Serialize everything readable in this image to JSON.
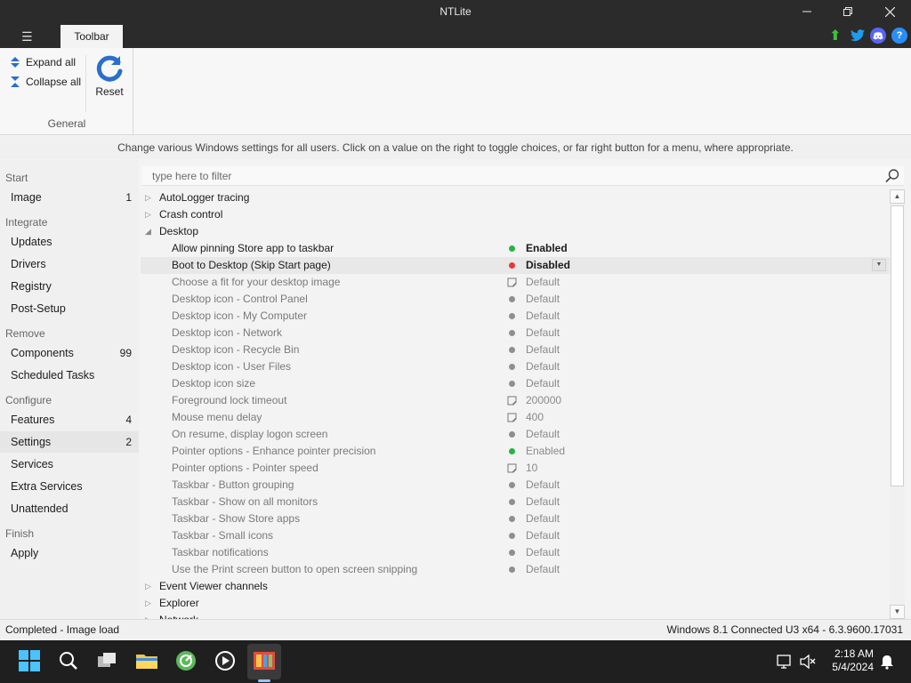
{
  "window": {
    "title": "NTLite"
  },
  "ribbon": {
    "tab": "Toolbar",
    "expand_all": "Expand all",
    "collapse_all": "Collapse all",
    "reset": "Reset",
    "group": "General"
  },
  "info": "Change various Windows settings for all users. Click on a value on the right to toggle choices, or far right button for a menu, where appropriate.",
  "sidebar": {
    "sections": [
      "Start",
      "Integrate",
      "Remove",
      "Configure",
      "Finish"
    ],
    "items": [
      {
        "label": "Image",
        "count": "1"
      },
      {
        "label": "Updates",
        "count": ""
      },
      {
        "label": "Drivers",
        "count": ""
      },
      {
        "label": "Registry",
        "count": ""
      },
      {
        "label": "Post-Setup",
        "count": ""
      },
      {
        "label": "Components",
        "count": "99"
      },
      {
        "label": "Scheduled Tasks",
        "count": ""
      },
      {
        "label": "Features",
        "count": "4"
      },
      {
        "label": "Settings",
        "count": "2"
      },
      {
        "label": "Services",
        "count": ""
      },
      {
        "label": "Extra Services",
        "count": ""
      },
      {
        "label": "Unattended",
        "count": ""
      },
      {
        "label": "Apply",
        "count": ""
      }
    ]
  },
  "filter": {
    "placeholder": "type here to filter"
  },
  "tree": {
    "categories_top": [
      "AutoLogger tracing",
      "Crash control",
      "Desktop"
    ],
    "settings": [
      {
        "name": "Allow pinning Store app to taskbar",
        "value": "Enabled",
        "status": "green"
      },
      {
        "name": "Boot to Desktop (Skip Start page)",
        "value": "Disabled",
        "status": "red"
      },
      {
        "name": "Choose a fit for your desktop image",
        "value": "Default",
        "status": "edit"
      },
      {
        "name": "Desktop icon - Control Panel",
        "value": "Default",
        "status": "grey"
      },
      {
        "name": "Desktop icon - My Computer",
        "value": "Default",
        "status": "grey"
      },
      {
        "name": "Desktop icon - Network",
        "value": "Default",
        "status": "grey"
      },
      {
        "name": "Desktop icon - Recycle Bin",
        "value": "Default",
        "status": "grey"
      },
      {
        "name": "Desktop icon - User Files",
        "value": "Default",
        "status": "grey"
      },
      {
        "name": "Desktop icon size",
        "value": "Default",
        "status": "grey"
      },
      {
        "name": "Foreground lock timeout",
        "value": "200000",
        "status": "edit"
      },
      {
        "name": "Mouse menu delay",
        "value": "400",
        "status": "edit"
      },
      {
        "name": "On resume, display logon screen",
        "value": "Default",
        "status": "grey"
      },
      {
        "name": "Pointer options - Enhance pointer precision",
        "value": "Enabled",
        "status": "green"
      },
      {
        "name": "Pointer options - Pointer speed",
        "value": "10",
        "status": "edit"
      },
      {
        "name": "Taskbar - Button grouping",
        "value": "Default",
        "status": "grey"
      },
      {
        "name": "Taskbar - Show on all monitors",
        "value": "Default",
        "status": "grey"
      },
      {
        "name": "Taskbar - Show Store apps",
        "value": "Default",
        "status": "grey"
      },
      {
        "name": "Taskbar - Small icons",
        "value": "Default",
        "status": "grey"
      },
      {
        "name": "Taskbar notifications",
        "value": "Default",
        "status": "grey"
      },
      {
        "name": "Use the Print screen button to open screen snipping",
        "value": "Default",
        "status": "grey"
      }
    ],
    "categories_bottom": [
      "Event Viewer channels",
      "Explorer",
      "Network"
    ]
  },
  "statusbar": {
    "left": "Completed - Image load",
    "right": "Windows 8.1 Connected U3 x64 - 6.3.9600.17031"
  },
  "taskbar": {
    "time": "2:18 AM",
    "date": "5/4/2024"
  },
  "colors": {
    "accent": "#2a6fc9",
    "enabled": "#27b444",
    "disabled": "#e5393b",
    "default": "#8f8f8f"
  }
}
